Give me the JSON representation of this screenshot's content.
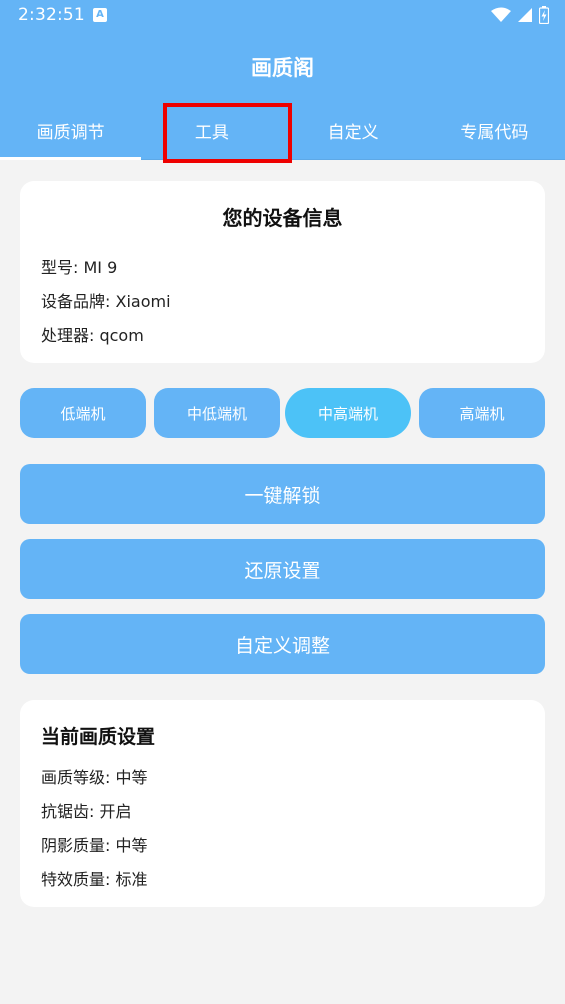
{
  "status": {
    "time": "2:32:51",
    "notif_letter": "A"
  },
  "app": {
    "title": "画质阁"
  },
  "tabs": [
    {
      "label": "画质调节",
      "active": true
    },
    {
      "label": "工具",
      "active": false
    },
    {
      "label": "自定义",
      "active": false
    },
    {
      "label": "专属代码",
      "active": false
    }
  ],
  "device": {
    "title": "您的设备信息",
    "lines": [
      "型号: MI 9",
      "设备品牌: Xiaomi",
      "处理器: qcom"
    ]
  },
  "tiers": [
    {
      "label": "低端机"
    },
    {
      "label": "中低端机"
    },
    {
      "label": "中高端机",
      "selected": true
    },
    {
      "label": "高端机"
    }
  ],
  "actions": {
    "unlock": "一键解锁",
    "restore": "还原设置",
    "custom": "自定义调整"
  },
  "current": {
    "title": "当前画质设置",
    "lines": [
      "画质等级: 中等",
      "抗锯齿: 开启",
      "阴影质量: 中等",
      "特效质量: 标准"
    ]
  },
  "colors": {
    "primary": "#64b4f6",
    "selected_tier": "#4cc2f7",
    "highlight": "#ee0000",
    "background": "#f3f3f3"
  }
}
